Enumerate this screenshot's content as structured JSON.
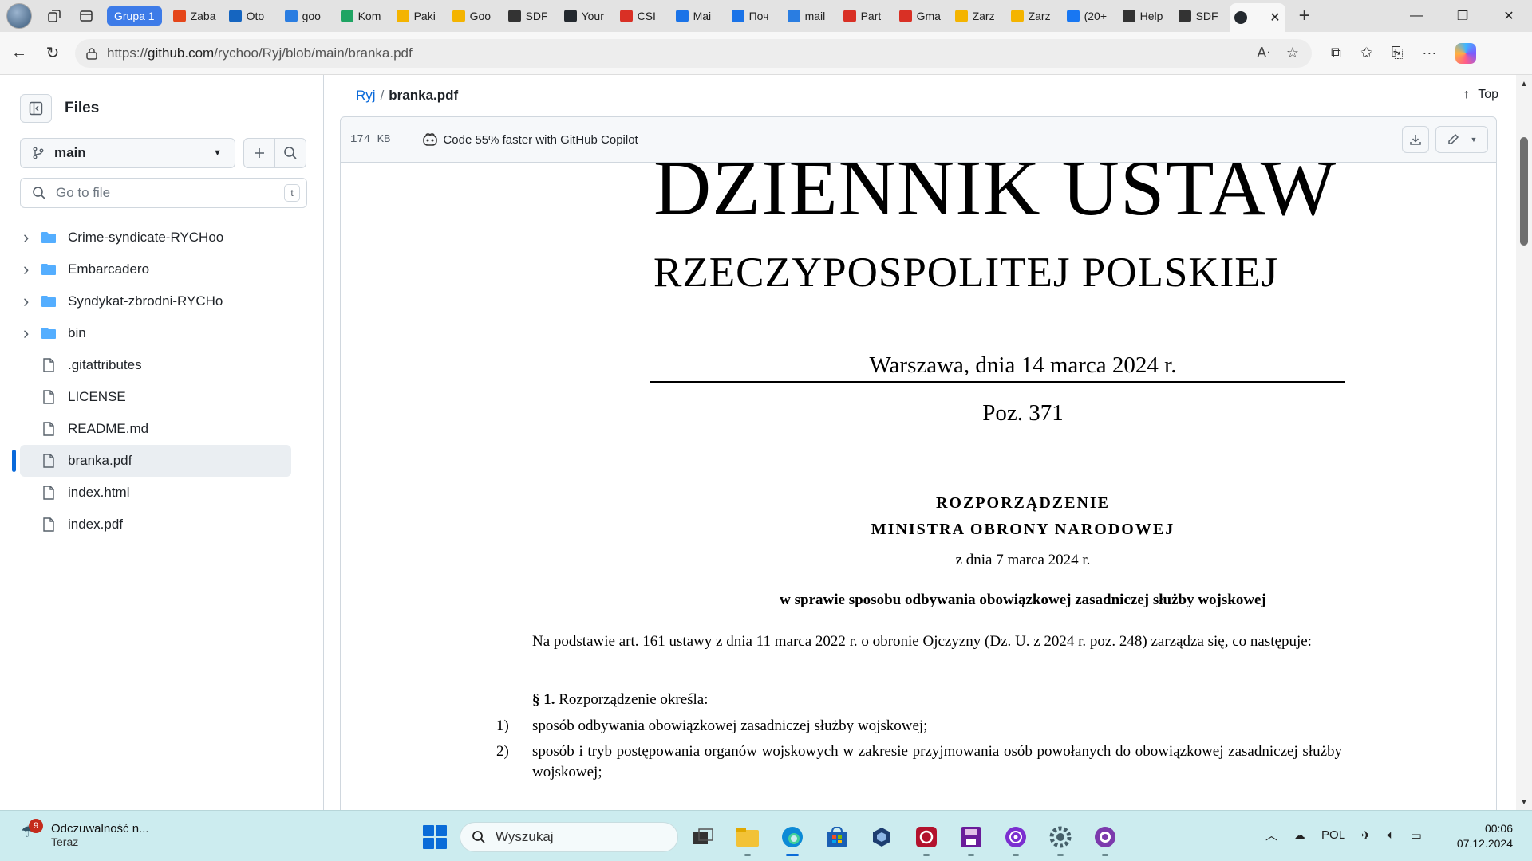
{
  "browser": {
    "group_label": "Grupa 1",
    "tabs": [
      {
        "label": "Zaba",
        "icon": "amazon-icon",
        "color": "#e5461a"
      },
      {
        "label": "Oto",
        "icon": "gk-icon",
        "color": "#1565c0"
      },
      {
        "label": "goo",
        "icon": "search-icon",
        "color": "#2a7de1"
      },
      {
        "label": "Kom",
        "icon": "drive-icon",
        "color": "#1fa463"
      },
      {
        "label": "Paki",
        "icon": "gemini-icon",
        "color": "#f4b400"
      },
      {
        "label": "Goo",
        "icon": "gemini-icon",
        "color": "#f4b400"
      },
      {
        "label": "SDF",
        "icon": "globe-icon",
        "color": "#333333"
      },
      {
        "label": "Your",
        "icon": "github-icon",
        "color": "#24292f"
      },
      {
        "label": "CSI_",
        "icon": "pdf-icon",
        "color": "#d93025"
      },
      {
        "label": "Mai",
        "icon": "at-icon",
        "color": "#1a73e8"
      },
      {
        "label": "Поч",
        "icon": "mail-icon",
        "color": "#1a73e8"
      },
      {
        "label": "mail",
        "icon": "search-icon",
        "color": "#2a7de1"
      },
      {
        "label": "Part",
        "icon": "gmail-icon",
        "color": "#d93025"
      },
      {
        "label": "Gma",
        "icon": "gmail-icon",
        "color": "#d93025"
      },
      {
        "label": "Zarz",
        "icon": "gemini-icon",
        "color": "#f4b400"
      },
      {
        "label": "Zarz",
        "icon": "gemini-icon",
        "color": "#f4b400"
      },
      {
        "label": "(20+",
        "icon": "facebook-icon",
        "color": "#1877f2"
      },
      {
        "label": "Help",
        "icon": "globe-icon",
        "color": "#333333"
      },
      {
        "label": "SDF",
        "icon": "globe-icon",
        "color": "#333333"
      }
    ],
    "url_prefix": "https://",
    "url_domain": "github.com",
    "url_path": "/rychoo/Ryj/blob/main/branka.pdf"
  },
  "sidebar": {
    "title": "Files",
    "branch": "main",
    "search_placeholder": "Go to file",
    "search_shortcut": "t",
    "items": [
      {
        "name": "Crime-syndicate-RYCHoo",
        "type": "folder"
      },
      {
        "name": "Embarcadero",
        "type": "folder"
      },
      {
        "name": "Syndykat-zbrodni-RYCHo",
        "type": "folder"
      },
      {
        "name": "bin",
        "type": "folder"
      },
      {
        "name": ".gitattributes",
        "type": "file"
      },
      {
        "name": "LICENSE",
        "type": "file"
      },
      {
        "name": "README.md",
        "type": "file"
      },
      {
        "name": "branka.pdf",
        "type": "file",
        "selected": true
      },
      {
        "name": "index.html",
        "type": "file"
      },
      {
        "name": "index.pdf",
        "type": "file"
      }
    ]
  },
  "header": {
    "repo": "Ryj",
    "separator": "/",
    "file": "branka.pdf",
    "top_label": "Top",
    "file_size": "174 KB",
    "copilot_promo": "Code 55% faster with GitHub Copilot"
  },
  "document": {
    "title": "DZIENNIK USTAW",
    "subtitle": "RZECZYPOSPOLITEJ POLSKIEJ",
    "place_date": "Warszawa, dnia 14 marca 2024 r.",
    "position": "Poz. 371",
    "act_type": "ROZPORZĄDZENIE",
    "issuer": "MINISTRA OBRONY NARODOWEJ",
    "act_date": "z dnia 7 marca 2024 r.",
    "subject": "w sprawie sposobu odbywania obowiązkowej zasadniczej służby wojskowej",
    "preamble": "Na podstawie art. 161 ustawy z dnia 11 marca 2022 r. o obronie Ojczyzny (Dz. U. z 2024 r. poz. 248) zarządza się, co następuje:",
    "par1_num": "§ 1.",
    "par1_text": "Rozporządzenie określa:",
    "list": [
      {
        "num": "1)",
        "text": "sposób odbywania obowiązkowej zasadniczej służby wojskowej;"
      },
      {
        "num": "2)",
        "text": "sposób i tryb postępowania organów wojskowych w zakresie przyjmowania osób powołanych do obowiązkowej zasadniczej służby wojskowej;"
      }
    ]
  },
  "taskbar": {
    "notification_count": "9",
    "notification_title": "Odczuwalność n...",
    "notification_time": "Teraz",
    "search_placeholder": "Wyszukaj",
    "language": "POL",
    "time": "00:06",
    "date": "07.12.2024"
  }
}
